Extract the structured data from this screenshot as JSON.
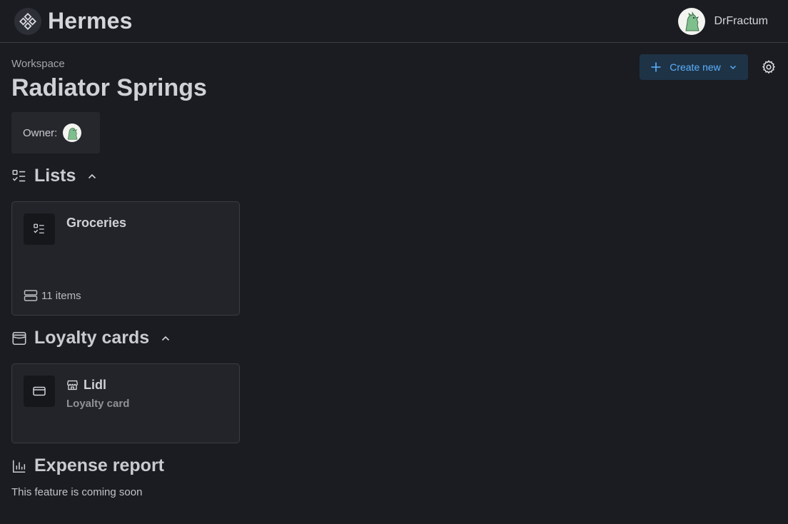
{
  "header": {
    "brand": "Hermes",
    "user_name": "DrFractum"
  },
  "workspace": {
    "eyebrow": "Workspace",
    "title": "Radiator Springs",
    "owner_label": "Owner:"
  },
  "actions": {
    "create_label": "Create new"
  },
  "lists": {
    "title": "Lists",
    "items": [
      {
        "title": "Groceries",
        "meta": "11 items"
      }
    ]
  },
  "loyalty": {
    "title": "Loyalty cards",
    "items": [
      {
        "title": "Lidl",
        "subtitle": "Loyalty card"
      }
    ]
  },
  "expense": {
    "title": "Expense report",
    "message": "This feature is coming soon"
  },
  "colors": {
    "background": "#1b1c21",
    "card": "#23242a",
    "accent": "#5bb1ff",
    "accent_bg": "#1e3346"
  },
  "icons": {
    "brand": "diamond-grid-icon",
    "create": "plus-icon",
    "dropdown": "chevron-down-icon",
    "settings": "gear-icon",
    "lists": "checklist-icon",
    "loyalty": "wallet-icon",
    "expense": "bar-chart-icon",
    "items": "stack-icon",
    "card": "credit-card-icon",
    "store": "store-icon"
  }
}
